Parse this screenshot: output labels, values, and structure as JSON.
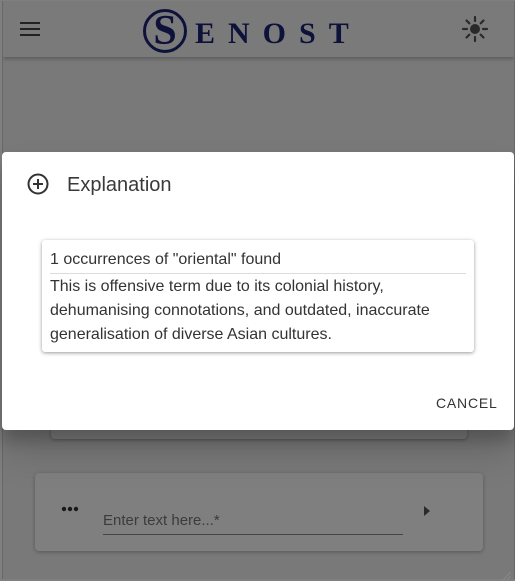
{
  "app": {
    "logo_initial": "S",
    "logo_text_a": "ENO",
    "logo_text_b": "ST",
    "icons": {
      "menu": "menu-icon",
      "theme": "brightness-icon"
    },
    "colors": {
      "logo": "#1d2475",
      "background": "#f3f3f3"
    }
  },
  "composer": {
    "placeholder": "Enter text here...*",
    "value": "",
    "icons": {
      "more": "more-horizontal-icon",
      "send": "play-arrow-icon"
    }
  },
  "dialog": {
    "title": "Explanation",
    "icon": "add-circle-icon",
    "match_header": "1 occurrences of \"oriental\" found",
    "explanation": "This is offensive term due to its colonial history, dehumanising connotations, and outdated, inaccurate generalisation of diverse Asian cultures.",
    "cancel_label": "CANCEL"
  }
}
